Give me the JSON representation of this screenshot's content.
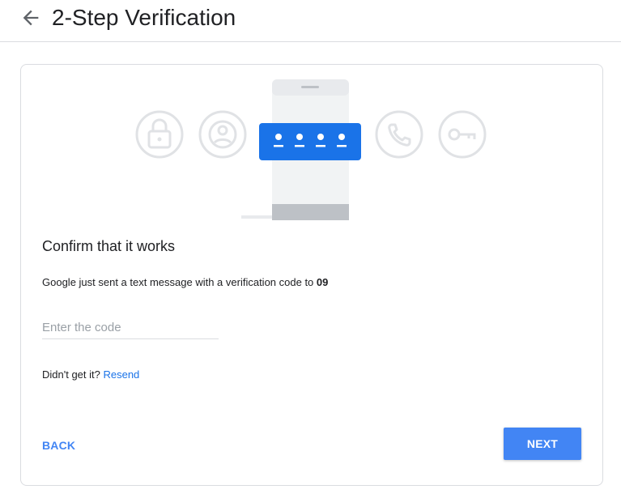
{
  "header": {
    "title": "2-Step Verification",
    "back_icon": "arrow-left-icon"
  },
  "illustration": {
    "icons": [
      "lock-icon",
      "account-circle-icon",
      "phone-icon",
      "key-icon"
    ],
    "code_dots_count": 4,
    "colors": {
      "accent_blue": "#1a73e8",
      "icon_gray": "#e8eaed",
      "phone_body": "#f1f3f4",
      "phone_bar": "#bdc1c6"
    }
  },
  "main": {
    "heading": "Confirm that it works",
    "message_prefix": "Google just sent a text message with a verification code to ",
    "phone_suffix": "09",
    "code_input": {
      "placeholder": "Enter the code",
      "value": ""
    },
    "resend_prompt": "Didn't get it? ",
    "resend_link": "Resend"
  },
  "actions": {
    "back_label": "BACK",
    "next_label": "NEXT"
  },
  "colors": {
    "primary": "#4285f4",
    "link": "#1a73e8",
    "text": "#202124",
    "border": "#dadce0"
  }
}
